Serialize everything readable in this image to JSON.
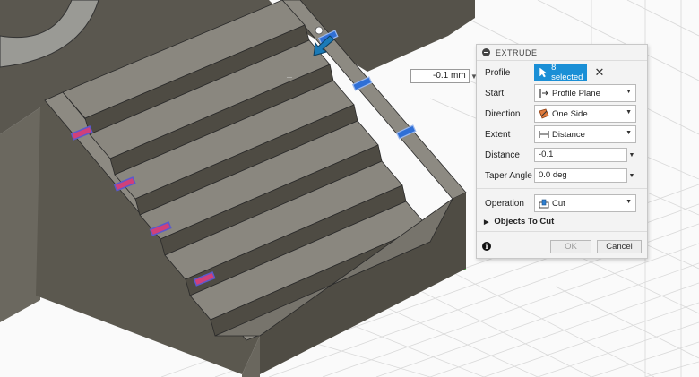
{
  "manipulator": {
    "distance_value": "-0.1 mm"
  },
  "dialog": {
    "title": "EXTRUDE",
    "profile": {
      "label": "Profile",
      "selection": "8 selected"
    },
    "start": {
      "label": "Start",
      "value": "Profile Plane",
      "icon": "profile-plane-icon"
    },
    "direction": {
      "label": "Direction",
      "value": "One Side",
      "icon": "one-side-icon"
    },
    "extent": {
      "label": "Extent",
      "value": "Distance",
      "icon": "distance-icon"
    },
    "distance": {
      "label": "Distance",
      "value": "-0.1"
    },
    "taper_angle": {
      "label": "Taper Angle",
      "value": "0.0 deg"
    },
    "operation": {
      "label": "Operation",
      "value": "Cut",
      "icon": "cut-icon"
    },
    "objects_to_cut": {
      "label": "Objects To Cut"
    },
    "ok_label": "OK",
    "cancel_label": "Cancel"
  },
  "colors": {
    "accent": "#1a8fd6",
    "model": "#5e5b52",
    "grid_origin": "#3fcf3f"
  }
}
